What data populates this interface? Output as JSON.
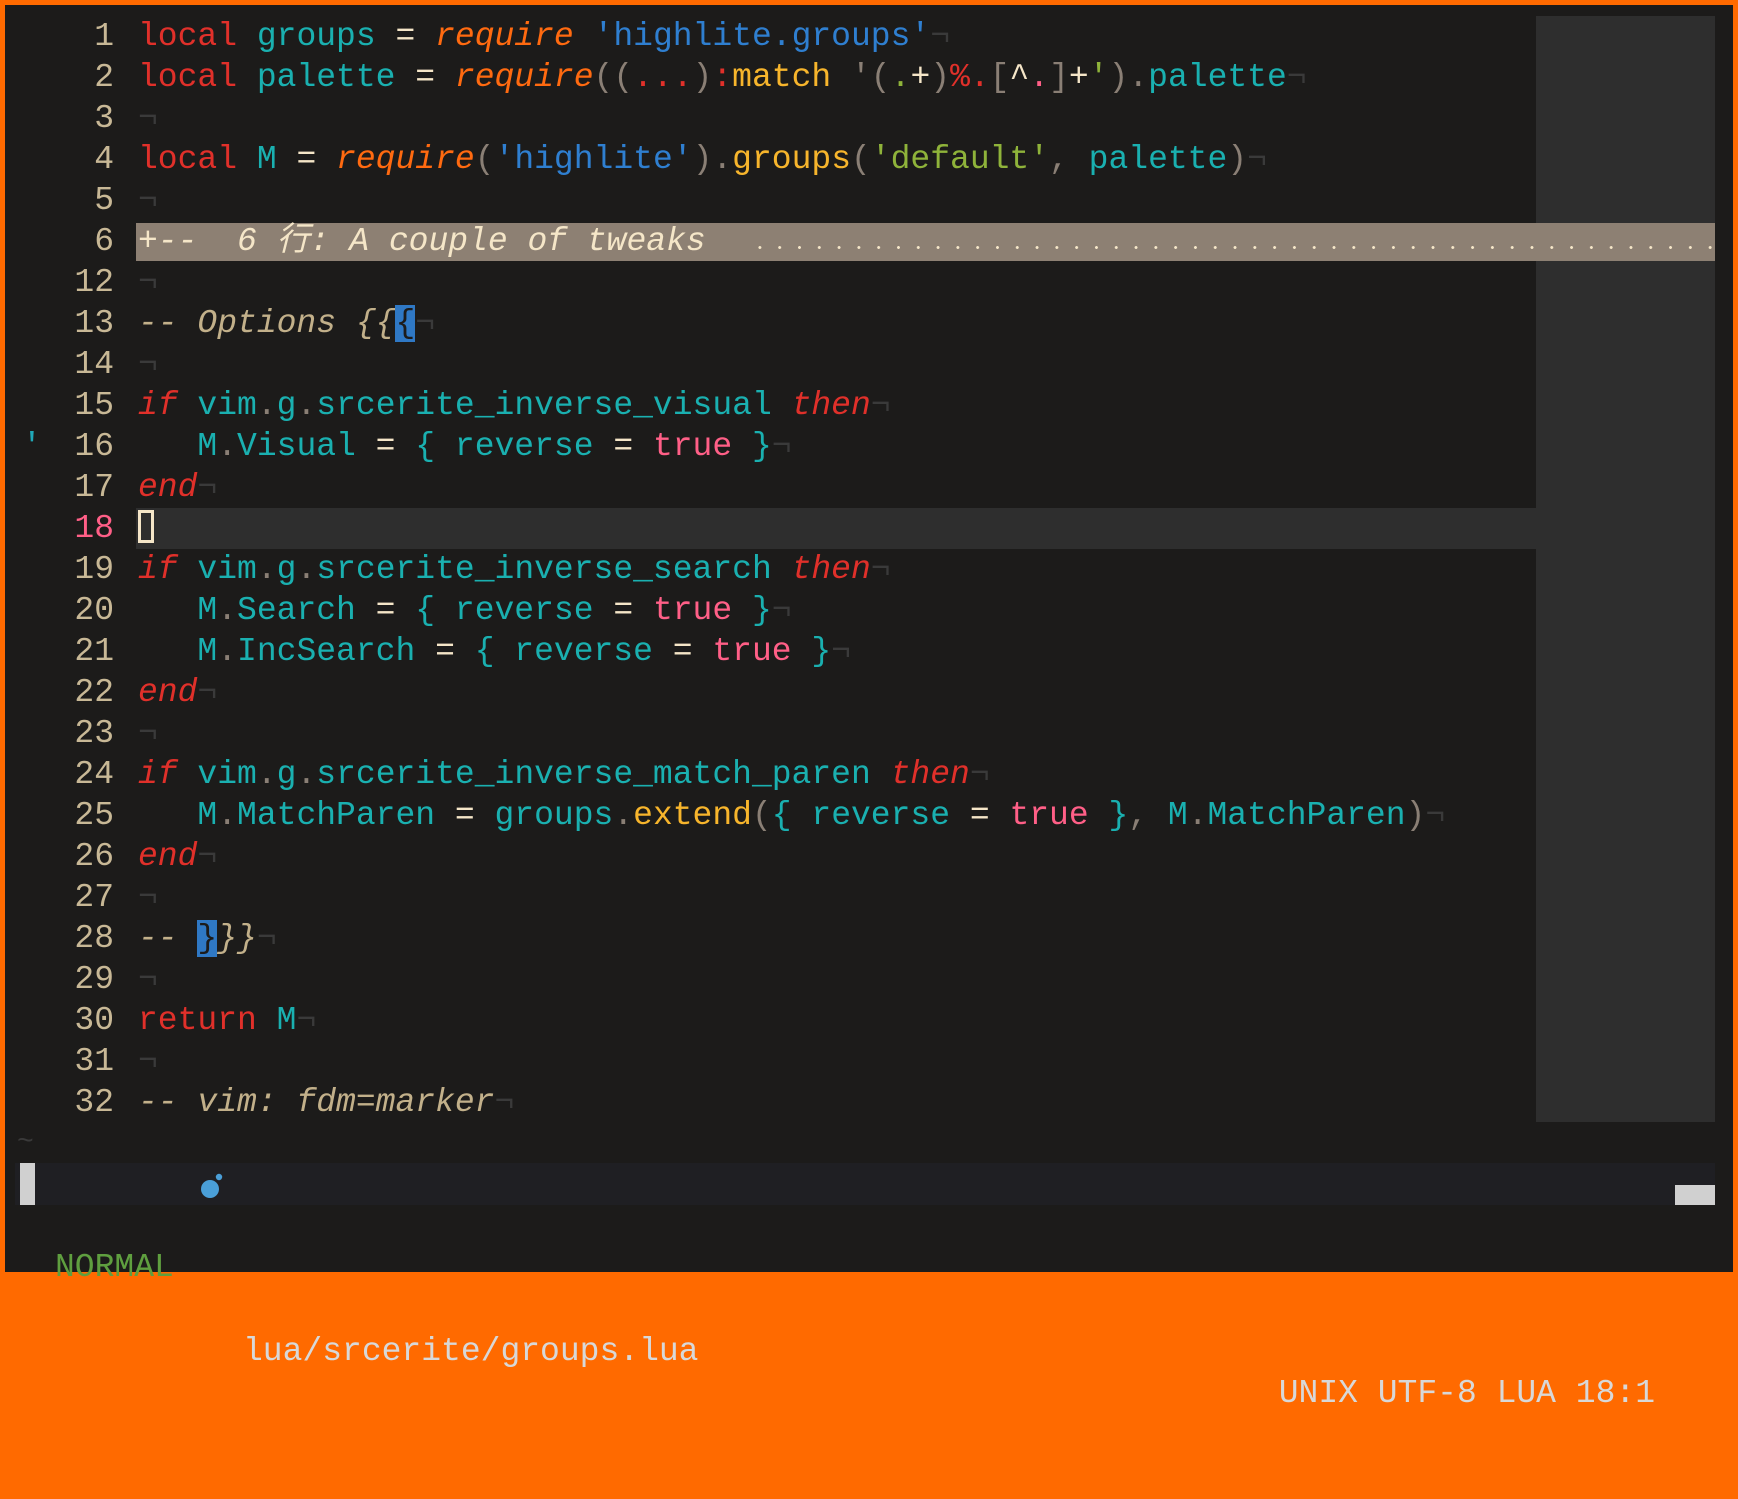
{
  "colors": {
    "window_border": "#ff6a00",
    "background": "#1c1b1a",
    "keyword": "#e0302a",
    "function": "#ff6a10",
    "identifier": "#1ab0b0",
    "string": "#2f7fd0",
    "string_alt": "#8fb33a",
    "method": "#f7b52c",
    "boolean": "#ff5f87",
    "comment": "#c2b08a",
    "fold_bg": "#8d8073",
    "mode_normal": "#5f9f3f"
  },
  "eol_char": "¬",
  "lines": [
    {
      "n": "1",
      "t": [
        [
          "local",
          "kw"
        ],
        [
          " ",
          ""
        ],
        [
          "groups",
          "id"
        ],
        [
          " = ",
          "op"
        ],
        [
          "require",
          "fn"
        ],
        [
          " ",
          ""
        ],
        [
          "'highlite.groups'",
          "str"
        ]
      ]
    },
    {
      "n": "2",
      "t": [
        [
          "local",
          "kw"
        ],
        [
          " ",
          ""
        ],
        [
          "palette",
          "id"
        ],
        [
          " = ",
          "op"
        ],
        [
          "require",
          "fn"
        ],
        [
          "((",
          "pu"
        ],
        [
          "...",
          "red"
        ],
        [
          ")",
          "pu"
        ],
        [
          ":",
          "red"
        ],
        [
          "match",
          "me"
        ],
        [
          " '(",
          "pu"
        ],
        [
          ".",
          "grn"
        ],
        [
          "+",
          "op"
        ],
        [
          ")",
          "pu"
        ],
        [
          "%.",
          "red"
        ],
        [
          "[",
          "pu"
        ],
        [
          "^",
          "op"
        ],
        [
          ".",
          "pink"
        ],
        [
          "]",
          "pu"
        ],
        [
          "+",
          "op"
        ],
        [
          "'",
          "grn"
        ],
        [
          ").",
          "pu"
        ],
        [
          "palette",
          "id"
        ]
      ]
    },
    {
      "n": "3",
      "t": []
    },
    {
      "n": "4",
      "t": [
        [
          "local",
          "kw"
        ],
        [
          " ",
          ""
        ],
        [
          "M",
          "id"
        ],
        [
          " = ",
          "op"
        ],
        [
          "require",
          "fn"
        ],
        [
          "(",
          "pu"
        ],
        [
          "'highlite'",
          "str"
        ],
        [
          ").",
          "pu"
        ],
        [
          "groups",
          "me"
        ],
        [
          "(",
          "pu"
        ],
        [
          "'default'",
          "str2"
        ],
        [
          ", ",
          "pu"
        ],
        [
          "palette",
          "id"
        ],
        [
          ")",
          "pu"
        ]
      ]
    },
    {
      "n": "5",
      "t": []
    },
    {
      "n": "6",
      "fold": "+--  6 行: A couple of tweaks"
    },
    {
      "n": "12",
      "t": []
    },
    {
      "n": "13",
      "t": [
        [
          "-- Options {{",
          "cm"
        ],
        [
          "{",
          "match"
        ]
      ]
    },
    {
      "n": "14",
      "t": []
    },
    {
      "n": "15",
      "t": [
        [
          "if",
          "ctl"
        ],
        [
          " ",
          ""
        ],
        [
          "vim",
          "id"
        ],
        [
          ".",
          "pu"
        ],
        [
          "g",
          "id"
        ],
        [
          ".",
          "pu"
        ],
        [
          "srcerite_inverse_visual",
          "id"
        ],
        [
          " ",
          ""
        ],
        [
          "then",
          "ctl"
        ]
      ]
    },
    {
      "n": "16",
      "sign": "'",
      "t": [
        [
          "   M",
          "id"
        ],
        [
          ".",
          "pu"
        ],
        [
          "Visual",
          "id"
        ],
        [
          " = ",
          "op"
        ],
        [
          "{ reverse",
          "id"
        ],
        [
          " = ",
          "op"
        ],
        [
          "true",
          "bool"
        ],
        [
          " }",
          "id"
        ]
      ]
    },
    {
      "n": "17",
      "t": [
        [
          "end",
          "ctl"
        ]
      ]
    },
    {
      "n": "18",
      "current": true,
      "t": []
    },
    {
      "n": "19",
      "t": [
        [
          "if",
          "ctl"
        ],
        [
          " ",
          ""
        ],
        [
          "vim",
          "id"
        ],
        [
          ".",
          "pu"
        ],
        [
          "g",
          "id"
        ],
        [
          ".",
          "pu"
        ],
        [
          "srcerite_inverse_search",
          "id"
        ],
        [
          " ",
          ""
        ],
        [
          "then",
          "ctl"
        ]
      ]
    },
    {
      "n": "20",
      "t": [
        [
          "   M",
          "id"
        ],
        [
          ".",
          "pu"
        ],
        [
          "Search",
          "id"
        ],
        [
          " = ",
          "op"
        ],
        [
          "{ reverse",
          "id"
        ],
        [
          " = ",
          "op"
        ],
        [
          "true",
          "bool"
        ],
        [
          " }",
          "id"
        ]
      ]
    },
    {
      "n": "21",
      "t": [
        [
          "   M",
          "id"
        ],
        [
          ".",
          "pu"
        ],
        [
          "IncSearch",
          "id"
        ],
        [
          " = ",
          "op"
        ],
        [
          "{ reverse",
          "id"
        ],
        [
          " = ",
          "op"
        ],
        [
          "true",
          "bool"
        ],
        [
          " }",
          "id"
        ]
      ]
    },
    {
      "n": "22",
      "t": [
        [
          "end",
          "ctl"
        ]
      ]
    },
    {
      "n": "23",
      "t": []
    },
    {
      "n": "24",
      "t": [
        [
          "if",
          "ctl"
        ],
        [
          " ",
          ""
        ],
        [
          "vim",
          "id"
        ],
        [
          ".",
          "pu"
        ],
        [
          "g",
          "id"
        ],
        [
          ".",
          "pu"
        ],
        [
          "srcerite_inverse_match_paren",
          "id"
        ],
        [
          " ",
          ""
        ],
        [
          "then",
          "ctl"
        ]
      ]
    },
    {
      "n": "25",
      "t": [
        [
          "   M",
          "id"
        ],
        [
          ".",
          "pu"
        ],
        [
          "MatchParen",
          "id"
        ],
        [
          " = ",
          "op"
        ],
        [
          "groups",
          "id"
        ],
        [
          ".",
          "pu"
        ],
        [
          "extend",
          "me"
        ],
        [
          "(",
          "pu"
        ],
        [
          "{ reverse",
          "id"
        ],
        [
          " = ",
          "op"
        ],
        [
          "true",
          "bool"
        ],
        [
          " }",
          "id"
        ],
        [
          ", ",
          "pu"
        ],
        [
          "M",
          "id"
        ],
        [
          ".",
          "pu"
        ],
        [
          "MatchParen",
          "id"
        ],
        [
          ")",
          "pu"
        ]
      ]
    },
    {
      "n": "26",
      "t": [
        [
          "end",
          "ctl"
        ]
      ]
    },
    {
      "n": "27",
      "t": []
    },
    {
      "n": "28",
      "t": [
        [
          "-- ",
          "cm"
        ],
        [
          "}",
          "match"
        ],
        [
          "}}",
          "cm"
        ]
      ]
    },
    {
      "n": "29",
      "t": []
    },
    {
      "n": "30",
      "t": [
        [
          "return",
          "kw"
        ],
        [
          " ",
          ""
        ],
        [
          "M",
          "id"
        ]
      ]
    },
    {
      "n": "31",
      "t": []
    },
    {
      "n": "32",
      "t": [
        [
          "-- vim: fdm=marker",
          "cm"
        ]
      ]
    }
  ],
  "tilde": "~",
  "statusline": {
    "mode": "NORMAL",
    "file_icon": "lua-icon",
    "filename": "lua/srcerite/groups.lua",
    "right": "UNIX UTF-8 LUA 18:1"
  }
}
